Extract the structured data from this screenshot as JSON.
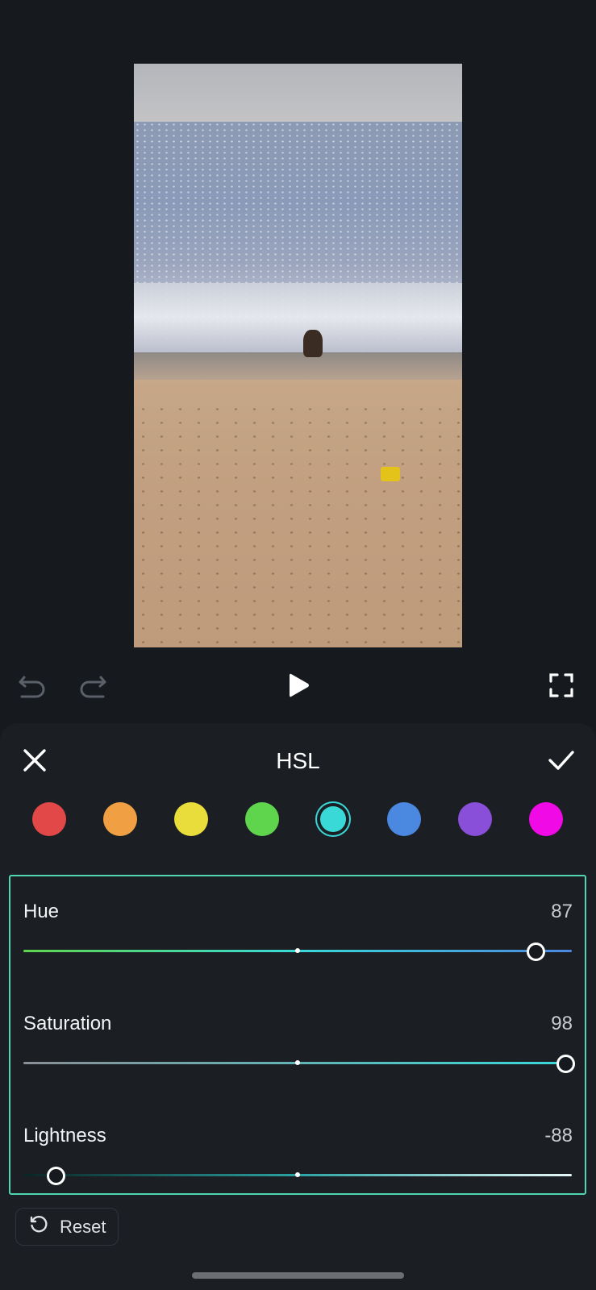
{
  "editor": {
    "preview_description": "beach video frame",
    "controls": [
      "undo-icon",
      "redo-icon",
      "play-icon",
      "fullscreen-icon"
    ]
  },
  "panel": {
    "title": "HSL",
    "close_icon": "close-icon",
    "confirm_icon": "check-icon",
    "colors": [
      {
        "name": "red",
        "hex": "#e24848"
      },
      {
        "name": "orange",
        "hex": "#f0a043"
      },
      {
        "name": "yellow",
        "hex": "#e8dd3b"
      },
      {
        "name": "green",
        "hex": "#5fd54e"
      },
      {
        "name": "cyan",
        "hex": "#39d9d8",
        "selected": true
      },
      {
        "name": "blue",
        "hex": "#4b88e0"
      },
      {
        "name": "purple",
        "hex": "#8a4fd9"
      },
      {
        "name": "magenta",
        "hex": "#f00ae6"
      }
    ],
    "sliders": [
      {
        "label": "Hue",
        "value": "87",
        "level": 87
      },
      {
        "label": "Saturation",
        "value": "98",
        "level": 98
      },
      {
        "label": "Lightness",
        "value": "-88",
        "level": -88
      }
    ],
    "reset_label": "Reset"
  }
}
